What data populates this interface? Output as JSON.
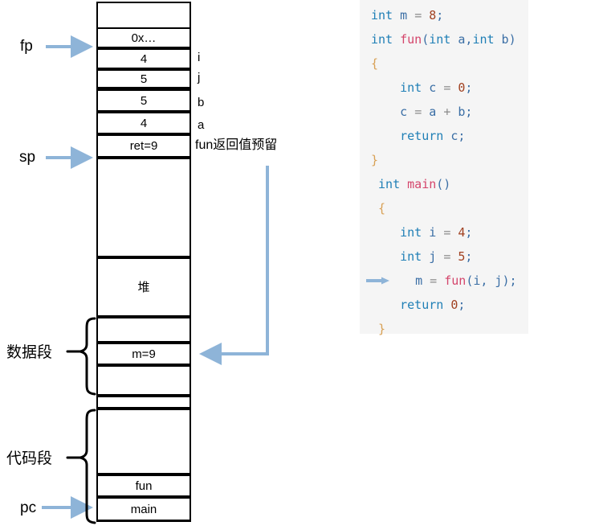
{
  "memory": {
    "pointers": [
      {
        "name": "fp",
        "label": "fp",
        "target_row": 1
      },
      {
        "name": "sp",
        "label": "sp",
        "target_row": 6
      }
    ],
    "rows": [
      {
        "id": "row-top-empty",
        "value": "",
        "note": ""
      },
      {
        "id": "row-saved-fp",
        "value": "0x…",
        "note": ""
      },
      {
        "id": "row-i",
        "value": "4",
        "note": "i"
      },
      {
        "id": "row-j",
        "value": "5",
        "note": "j"
      },
      {
        "id": "row-b",
        "value": "5",
        "note": "b"
      },
      {
        "id": "row-a",
        "value": "4",
        "note": "a"
      },
      {
        "id": "row-ret",
        "value": "ret=9",
        "note": "fun返回值预留"
      },
      {
        "id": "row-stack-free",
        "value": "",
        "note": ""
      },
      {
        "id": "row-heap",
        "value": "堆",
        "note": ""
      },
      {
        "id": "row-data-empty1",
        "value": "",
        "note": ""
      },
      {
        "id": "row-m",
        "value": "m=9",
        "note": ""
      },
      {
        "id": "row-data-empty2",
        "value": "",
        "note": ""
      },
      {
        "id": "row-gap",
        "value": "",
        "note": ""
      },
      {
        "id": "row-code-empty",
        "value": "",
        "note": ""
      },
      {
        "id": "row-fun",
        "value": "fun",
        "note": ""
      },
      {
        "id": "row-main",
        "value": "main",
        "note": ""
      }
    ],
    "segments": [
      {
        "id": "data-segment",
        "label": "数据段"
      },
      {
        "id": "code-segment",
        "label": "代码段"
      }
    ],
    "pc": {
      "label": "pc",
      "target_row": 15
    },
    "ret_arrow_note": "fun返回值预留"
  },
  "code": {
    "lines": [
      {
        "id": "l1",
        "tokens": [
          {
            "t": "int",
            "c": "kw"
          },
          {
            "t": " m ",
            "c": "pl"
          },
          {
            "t": "=",
            "c": "op"
          },
          {
            "t": " ",
            "c": "pl"
          },
          {
            "t": "8",
            "c": "num"
          },
          {
            "t": ";",
            "c": "pl"
          }
        ]
      },
      {
        "id": "l2",
        "tokens": [
          {
            "t": "int ",
            "c": "kw"
          },
          {
            "t": "fun",
            "c": "fn"
          },
          {
            "t": "(",
            "c": "pl"
          },
          {
            "t": "int",
            "c": "kw"
          },
          {
            "t": " a,",
            "c": "pl"
          },
          {
            "t": "int",
            "c": "kw"
          },
          {
            "t": " b",
            "c": "pl"
          },
          {
            "t": ")",
            "c": "pl"
          }
        ]
      },
      {
        "id": "l3",
        "tokens": [
          {
            "t": "{",
            "c": "brace"
          }
        ]
      },
      {
        "id": "l4",
        "tokens": [
          {
            "t": "    ",
            "c": "pl"
          },
          {
            "t": "int",
            "c": "kw"
          },
          {
            "t": " c ",
            "c": "pl"
          },
          {
            "t": "=",
            "c": "op"
          },
          {
            "t": " ",
            "c": "pl"
          },
          {
            "t": "0",
            "c": "num"
          },
          {
            "t": ";",
            "c": "pl"
          }
        ]
      },
      {
        "id": "l5",
        "tokens": [
          {
            "t": "    c ",
            "c": "pl"
          },
          {
            "t": "=",
            "c": "op"
          },
          {
            "t": " a ",
            "c": "pl"
          },
          {
            "t": "+",
            "c": "op"
          },
          {
            "t": " b;",
            "c": "pl"
          }
        ]
      },
      {
        "id": "l6",
        "tokens": [
          {
            "t": "    ",
            "c": "pl"
          },
          {
            "t": "return",
            "c": "kw"
          },
          {
            "t": " c;",
            "c": "pl"
          }
        ]
      },
      {
        "id": "l7",
        "tokens": [
          {
            "t": "}",
            "c": "brace"
          }
        ]
      },
      {
        "id": "l8",
        "tokens": [
          {
            "t": " ",
            "c": "pl"
          },
          {
            "t": "int ",
            "c": "kw"
          },
          {
            "t": "main",
            "c": "fn"
          },
          {
            "t": "()",
            "c": "pl"
          }
        ]
      },
      {
        "id": "l9",
        "tokens": [
          {
            "t": " ",
            "c": "pl"
          },
          {
            "t": "{",
            "c": "brace"
          }
        ]
      },
      {
        "id": "l10",
        "tokens": [
          {
            "t": "    ",
            "c": "pl"
          },
          {
            "t": "int",
            "c": "kw"
          },
          {
            "t": " i ",
            "c": "pl"
          },
          {
            "t": "=",
            "c": "op"
          },
          {
            "t": " ",
            "c": "pl"
          },
          {
            "t": "4",
            "c": "num"
          },
          {
            "t": ";",
            "c": "pl"
          }
        ]
      },
      {
        "id": "l11",
        "tokens": [
          {
            "t": "    ",
            "c": "pl"
          },
          {
            "t": "int",
            "c": "kw"
          },
          {
            "t": " j ",
            "c": "pl"
          },
          {
            "t": "=",
            "c": "op"
          },
          {
            "t": " ",
            "c": "pl"
          },
          {
            "t": "5",
            "c": "num"
          },
          {
            "t": ";",
            "c": "pl"
          }
        ]
      },
      {
        "id": "l12",
        "arrow": true,
        "tokens": [
          {
            "t": "   m ",
            "c": "pl"
          },
          {
            "t": "=",
            "c": "op"
          },
          {
            "t": " ",
            "c": "pl"
          },
          {
            "t": "fun",
            "c": "fn"
          },
          {
            "t": "(i, j);",
            "c": "pl"
          }
        ]
      },
      {
        "id": "l13",
        "tokens": [
          {
            "t": "    ",
            "c": "pl"
          },
          {
            "t": "return",
            "c": "kw"
          },
          {
            "t": " ",
            "c": "pl"
          },
          {
            "t": "0",
            "c": "num"
          },
          {
            "t": ";",
            "c": "pl"
          }
        ]
      },
      {
        "id": "l14",
        "tokens": [
          {
            "t": " ",
            "c": "pl"
          },
          {
            "t": "}",
            "c": "brace"
          }
        ]
      }
    ],
    "current_line_marker": "arrow-right-icon"
  },
  "colors": {
    "arrow_blue": "#8eb4d8",
    "panel_bg": "#f5f5f5",
    "keyword": "#1f7fb6",
    "function": "#d4456b",
    "number": "#a04020",
    "brace": "#d8a054",
    "operator": "#8a8a8a",
    "plain": "#3a6ea5",
    "cell_border": "#000000"
  }
}
